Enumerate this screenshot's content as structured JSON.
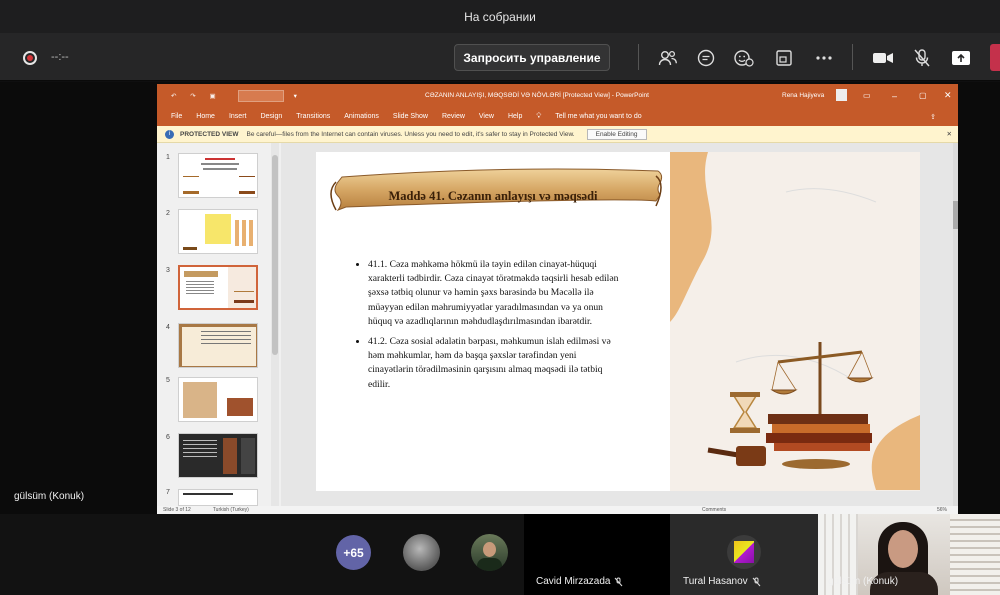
{
  "window": {
    "title": "На собрании"
  },
  "toolbar": {
    "timer": "--:--",
    "request_control": "Запросить управление"
  },
  "stage": {
    "participant_label": "gülsüm (Konuk)"
  },
  "ppt": {
    "title": "CƏZANIN ANLAYIŞI, MƏQSƏDİ VƏ NÖVLƏRİ [Protected View] - PowerPoint",
    "user": "Rena Hajiyeva",
    "tabs": [
      "File",
      "Home",
      "Insert",
      "Design",
      "Transitions",
      "Animations",
      "Slide Show",
      "Review",
      "View",
      "Help"
    ],
    "tell_me": "Tell me what you want to do",
    "protected_label": "PROTECTED VIEW",
    "protected_msg": "Be careful—files from the Internet can contain viruses. Unless you need to edit, it's safer to stay in Protected View.",
    "enable_editing": "Enable Editing",
    "status_slide": "Slide 3 of 12",
    "status_lang": "Turkish (Turkey)",
    "status_comments": "Comments",
    "status_zoom": "56%",
    "thumb_numbers": [
      "1",
      "2",
      "3",
      "4",
      "5",
      "6",
      "7"
    ]
  },
  "slide": {
    "heading": "Maddə 41. Cəzanın anlayışı və məqsədi",
    "bullets": [
      "41.1. Cəza məhkəmə hökmü ilə təyin edilən cinayət-hüquqi xarakterli tədbirdir. Cəza cinayət törətməkdə təqsirli hesab edilən şəxsə tətbiq olunur və həmin şəxs barəsində bu Məcəllə ilə müəyyən edilən məhrumiyyətlər yaradılmasından və ya onun hüquq və azadlıqlarının məhdudlaşdırılmasından ibarətdir.",
      "41.2. Cəza sosial ədalətin bərpası, məhkumun islah edilməsi və həm məhkumlar, həm də başqa şəxslər tərəfindən yeni cinayətlərin törədilməsinin qarşısını almaq məqsədi ilə tətbiq edilir."
    ]
  },
  "participants": {
    "more": "+65",
    "p1": "Cavid Mirzazada",
    "p2": "Tural Hasanov",
    "p3": "gülsüm (Konuk)"
  },
  "colors": {
    "accent": "#c55a29",
    "record": "#d13438",
    "end_call": "#c4314b",
    "teams_purple": "#6264a7"
  }
}
